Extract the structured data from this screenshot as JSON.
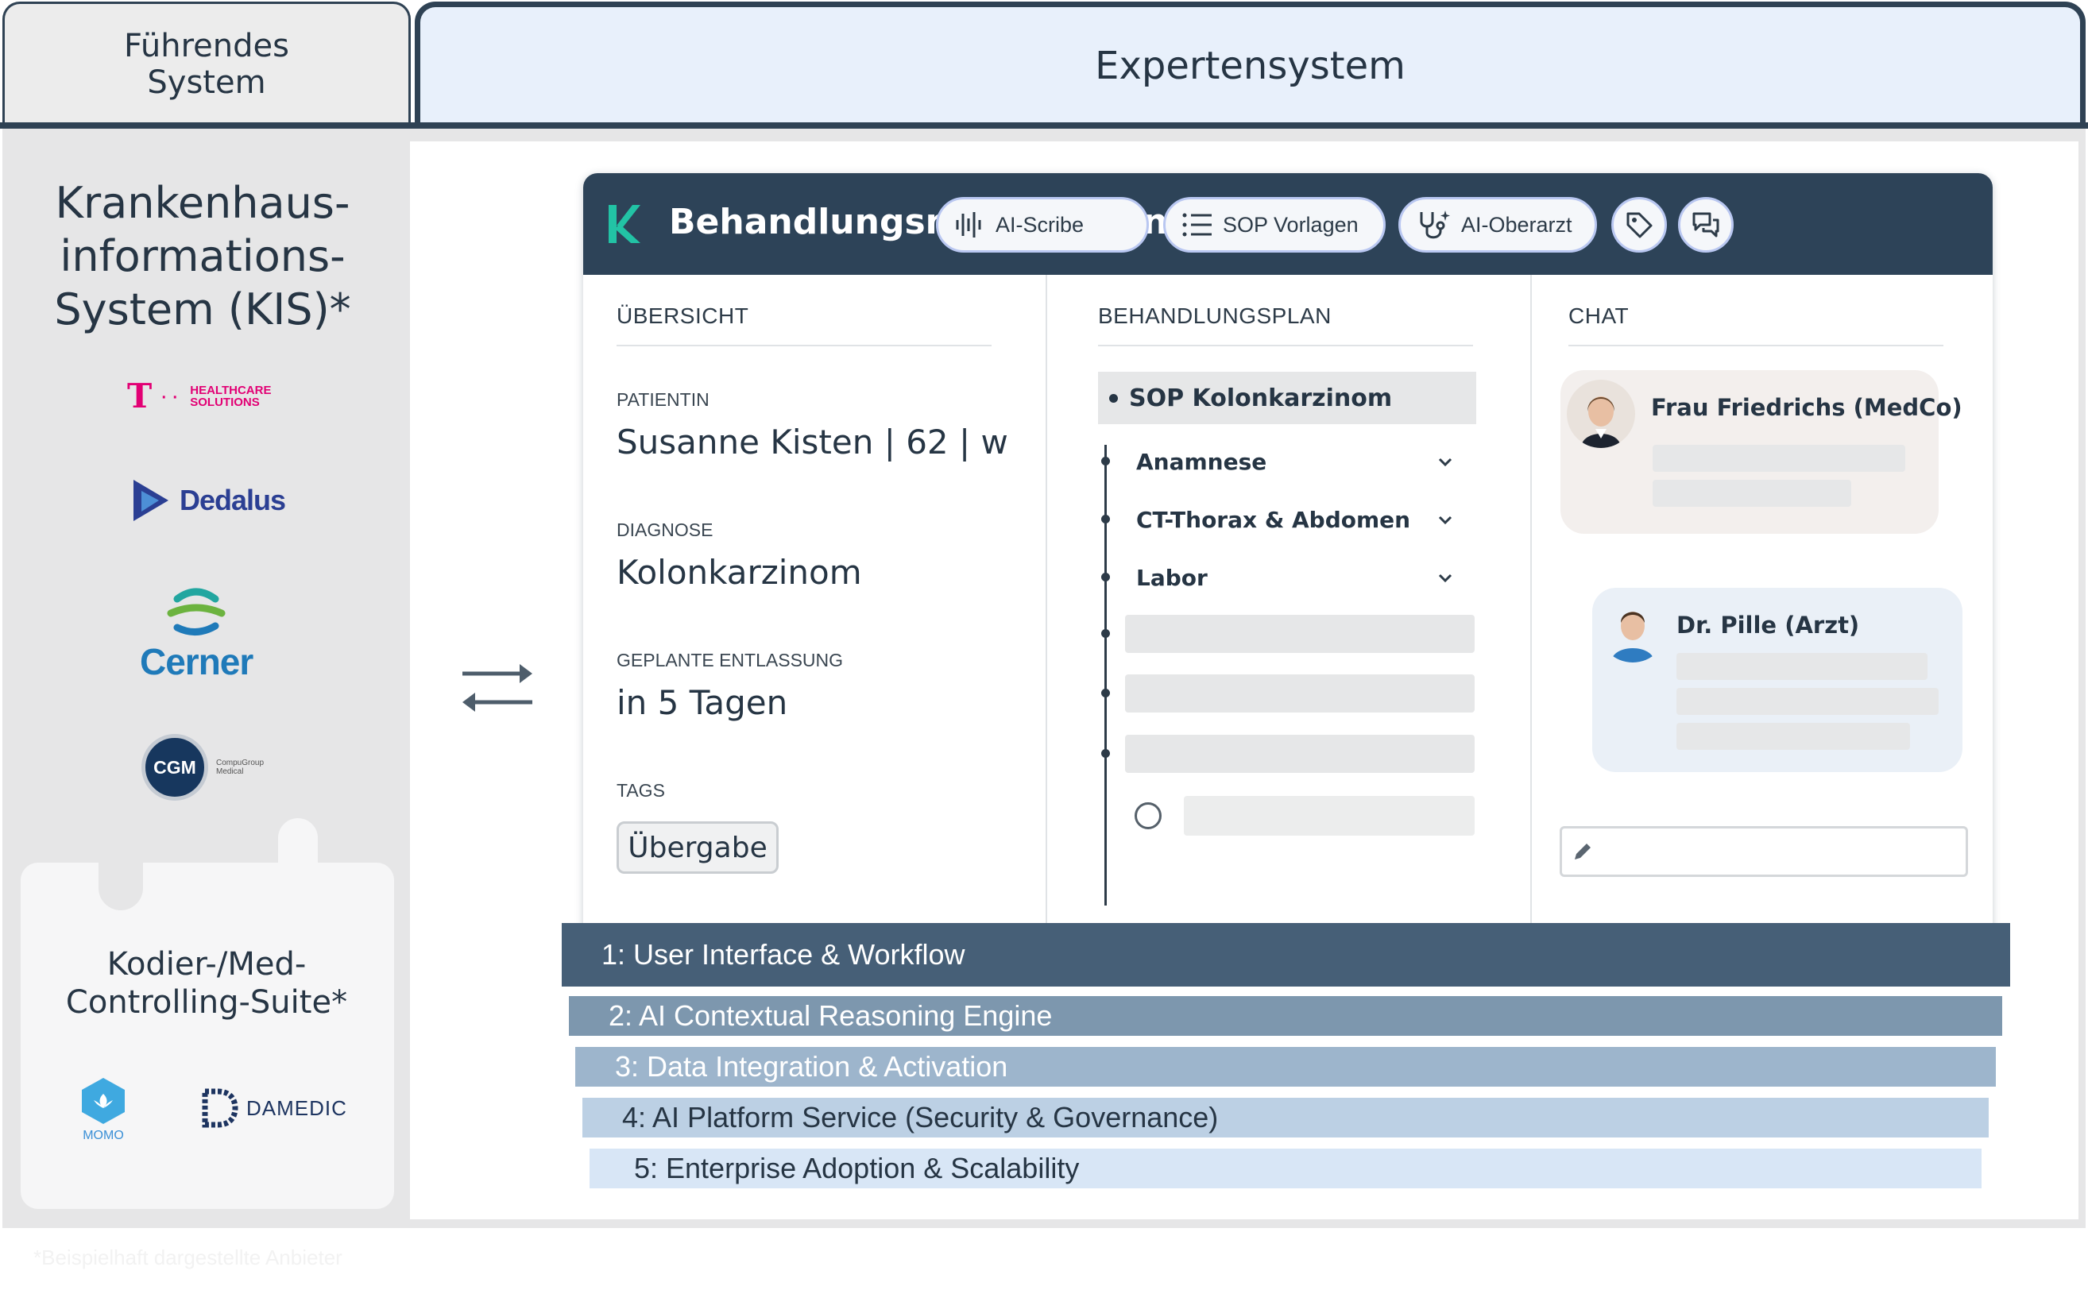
{
  "tabs": {
    "left_label": "Führendes\nSystem",
    "right_label": "Expertensystem"
  },
  "left_panel": {
    "kis_title": "Krankenhaus-\ninformations-\nSystem (KIS)*",
    "kis_logos": [
      {
        "name": "HEALTHCARE\nSOLUTIONS"
      },
      {
        "name": "Dedalus"
      },
      {
        "name": "Cerner"
      },
      {
        "name": "CGM",
        "sub": "CompuGroup\nMedical"
      }
    ],
    "suite_title": "Kodier-/Med-\nControlling-Suite*",
    "suite_logos": [
      {
        "name": "MOMO"
      },
      {
        "name": "DAMEDIC"
      }
    ]
  },
  "app": {
    "title": "Behandlungsmanagement",
    "toolbar": {
      "ai_scribe": "AI-Scribe",
      "sop_vorlagen": "SOP Vorlagen",
      "ai_oberarzt": "AI-Oberarzt"
    },
    "overview": {
      "heading": "ÜBERSICHT",
      "patient_label": "PATIENTIN",
      "patient_value": "Susanne Kisten | 62 | w",
      "diagnosis_label": "DIAGNOSE",
      "diagnosis_value": "Kolonkarzinom",
      "discharge_label": "GEPLANTE ENTLASSUNG",
      "discharge_value": "in 5 Tagen",
      "tags_label": "TAGS",
      "tag": "Übergabe"
    },
    "plan": {
      "heading": "BEHANDLUNGSPLAN",
      "sop": "SOP Kolonkarzinom",
      "items": [
        "Anamnese",
        "CT-Thorax & Abdomen",
        "Labor"
      ]
    },
    "chat": {
      "heading": "CHAT",
      "messages": [
        {
          "author": "Frau Friedrichs (MedCo)"
        },
        {
          "author": "Dr. Pille (Arzt)"
        }
      ]
    }
  },
  "layers": [
    "1: User Interface & Workflow",
    "2: AI Contextual Reasoning Engine",
    "3: Data Integration & Activation",
    "4: AI Platform Service (Security & Governance)",
    "5: Enterprise Adoption & Scalability"
  ],
  "footnote": "*Beispielhaft dargestellte Anbieter",
  "colors": {
    "navy": "#2d4358",
    "layer1": "#465f77",
    "layer2": "#7d97ae",
    "layer3": "#9db5cc",
    "layer4": "#bcd0e4",
    "layer5": "#d8e6f6",
    "accent_teal": "#22c3a5"
  }
}
